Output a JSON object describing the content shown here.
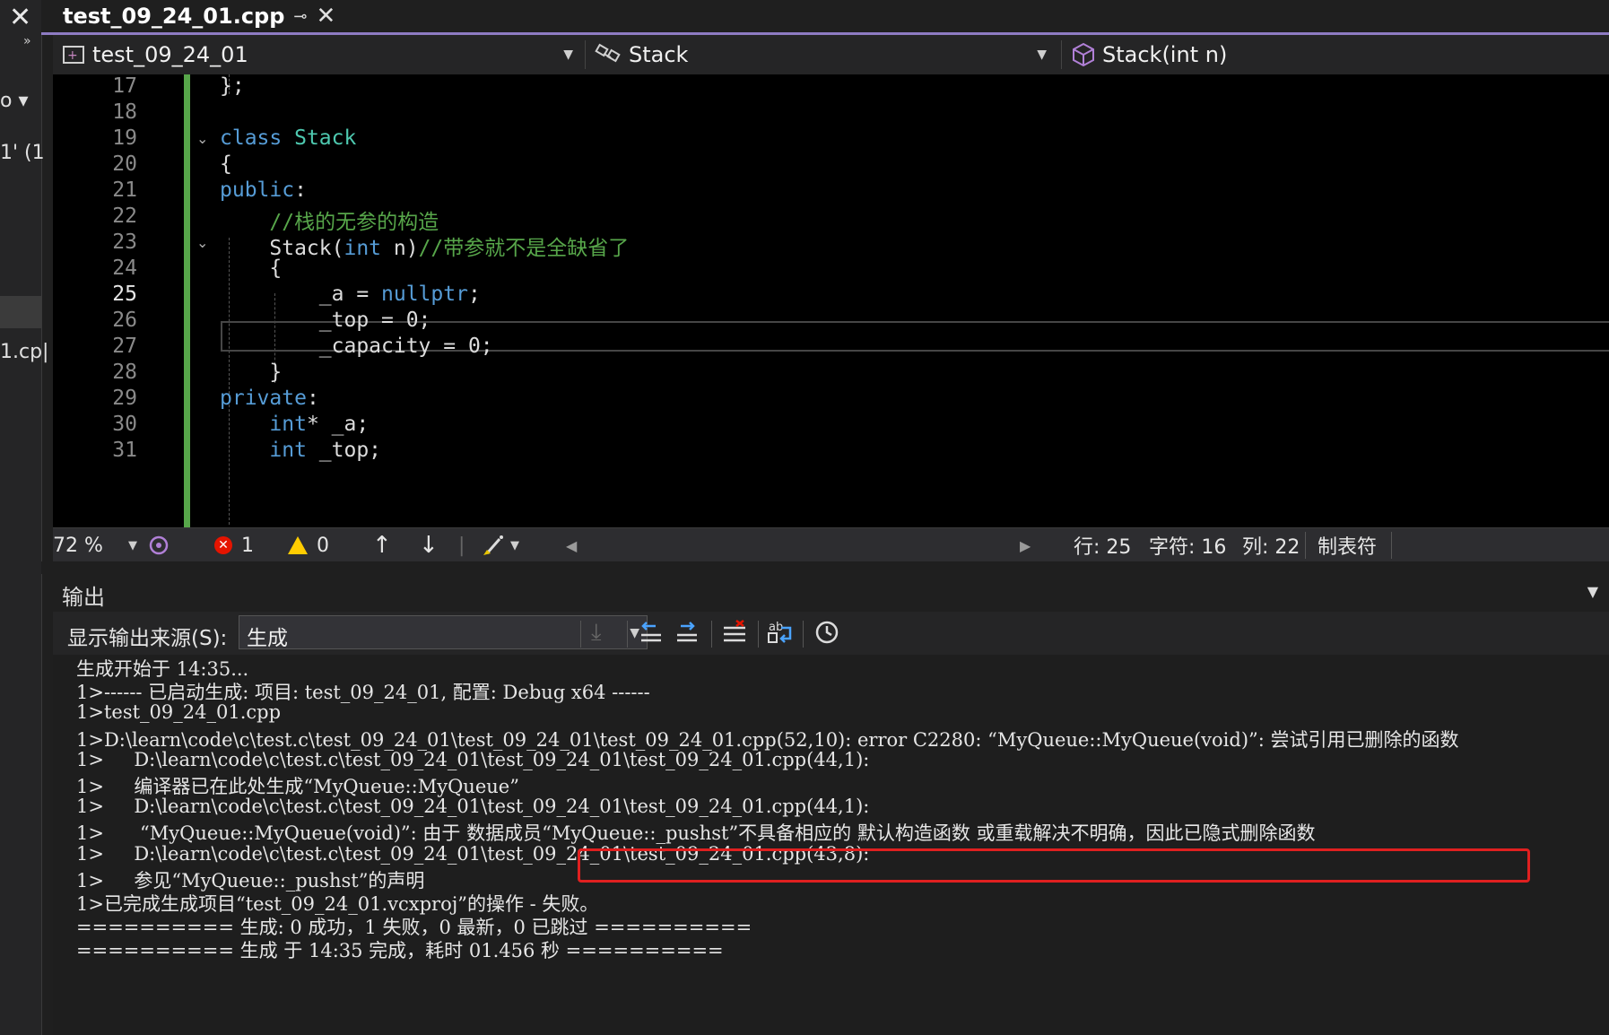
{
  "tab": {
    "title": "test_09_24_01.cpp",
    "pin": "⊸",
    "close": "✕"
  },
  "left_strip": {
    "close": "✕",
    "chev": "»",
    "frag1": "o ▾",
    "frag2": "1' (1",
    "frag3": "1.cp|"
  },
  "nav": {
    "project": "test_09_24_01",
    "class": "Stack",
    "member": "Stack(int n)"
  },
  "editor": {
    "line_numbers": [
      "17",
      "18",
      "19",
      "20",
      "21",
      "22",
      "23",
      "24",
      "25",
      "26",
      "27",
      "28",
      "29",
      "30",
      "31"
    ],
    "current_line": "25",
    "lines": [
      [
        {
          "t": "};",
          "c": ""
        }
      ],
      [],
      [
        {
          "t": "class ",
          "c": "kw"
        },
        {
          "t": "Stack",
          "c": "ty"
        }
      ],
      [
        {
          "t": "{",
          "c": ""
        }
      ],
      [
        {
          "t": "public",
          "c": "kw"
        },
        {
          "t": ":",
          "c": ""
        }
      ],
      [
        {
          "t": "    //栈的无参的构造",
          "c": "cm"
        }
      ],
      [
        {
          "t": "    Stack(",
          "c": ""
        },
        {
          "t": "int",
          "c": "kw"
        },
        {
          "t": " n)",
          "c": ""
        },
        {
          "t": "//带参就不是全缺省了",
          "c": "cm"
        }
      ],
      [
        {
          "t": "    {",
          "c": ""
        }
      ],
      [
        {
          "t": "        _a = ",
          "c": ""
        },
        {
          "t": "nullptr",
          "c": "kw"
        },
        {
          "t": ";",
          "c": ""
        }
      ],
      [
        {
          "t": "        _top = 0;",
          "c": ""
        }
      ],
      [
        {
          "t": "        _capacity = 0;",
          "c": ""
        }
      ],
      [
        {
          "t": "    }",
          "c": ""
        }
      ],
      [
        {
          "t": "private",
          "c": "kw"
        },
        {
          "t": ":",
          "c": ""
        }
      ],
      [
        {
          "t": "    ",
          "c": ""
        },
        {
          "t": "int",
          "c": "kw"
        },
        {
          "t": "* _a;",
          "c": ""
        }
      ],
      [
        {
          "t": "    ",
          "c": ""
        },
        {
          "t": "int",
          "c": "kw"
        },
        {
          "t": " _top;",
          "c": ""
        }
      ]
    ]
  },
  "status": {
    "zoom": "72 %",
    "errors": "1",
    "warnings": "0",
    "row": "行: 25",
    "char": "字符: 16",
    "col": "列: 22",
    "tab_mode": "制表符"
  },
  "output": {
    "title": "输出",
    "source_label": "显示输出来源(S):",
    "source_value": "生成",
    "lines": [
      "生成开始于 14:35...",
      "1>------ 已启动生成: 项目: test_09_24_01, 配置: Debug x64 ------",
      "1>test_09_24_01.cpp",
      "1>D:\\learn\\code\\c\\test.c\\test_09_24_01\\test_09_24_01\\test_09_24_01.cpp(52,10): error C2280: “MyQueue::MyQueue(void)”: 尝试引用已删除的函数",
      "1>     D:\\learn\\code\\c\\test.c\\test_09_24_01\\test_09_24_01\\test_09_24_01.cpp(44,1):",
      "1>     编译器已在此处生成“MyQueue::MyQueue”",
      "1>     D:\\learn\\code\\c\\test.c\\test_09_24_01\\test_09_24_01\\test_09_24_01.cpp(44,1):",
      "1>      “MyQueue::MyQueue(void)”: 由于 数据成员“MyQueue::_pushst”不具备相应的 默认构造函数 或重载解决不明确，因此已隐式删除函数",
      "1>     D:\\learn\\code\\c\\test.c\\test_09_24_01\\test_09_24_01\\test_09_24_01.cpp(43,8):",
      "1>     参见“MyQueue::_pushst”的声明",
      "1>已完成生成项目“test_09_24_01.vcxproj”的操作 - 失败。",
      "========== 生成: 0 成功，1 失败，0 最新，0 已跳过 ==========",
      "========== 生成 于 14:35 完成，耗时 01.456 秒 =========="
    ]
  }
}
